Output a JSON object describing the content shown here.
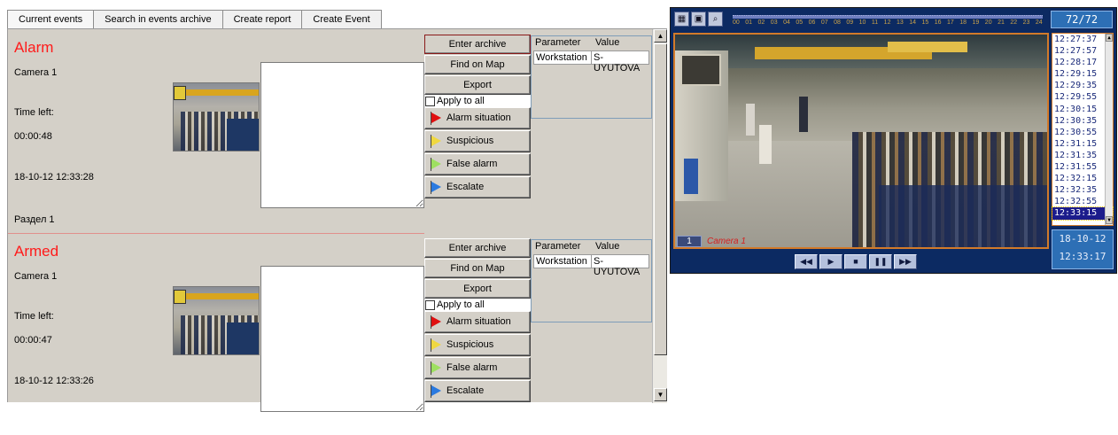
{
  "tabs": [
    {
      "label": "Current events"
    },
    {
      "label": "Search in events archive"
    },
    {
      "label": "Create report"
    },
    {
      "label": "Create Event"
    }
  ],
  "events": [
    {
      "title": "Alarm",
      "camera": "Camera 1",
      "time_left_label": "Time left:",
      "time_left": "00:00:48",
      "datetime": "18-10-12 12:33:28",
      "section": "Раздел 1",
      "params": {
        "header_param": "Parameter",
        "header_value": "Value",
        "rows": [
          {
            "param": "Workstation",
            "value": "S-UYUTOVA"
          }
        ]
      }
    },
    {
      "title": "Armed",
      "camera": "Camera 1",
      "time_left_label": "Time left:",
      "time_left": "00:00:47",
      "datetime": "18-10-12 12:33:26",
      "section": "",
      "params": {
        "header_param": "Parameter",
        "header_value": "Value",
        "rows": [
          {
            "param": "Workstation",
            "value": "S-UYUTOVA"
          }
        ]
      }
    }
  ],
  "buttons": {
    "enter_archive": "Enter archive",
    "find_on_map": "Find on Map",
    "export": "Export",
    "apply_to_all": "Apply to all",
    "alarm_situation": "Alarm situation",
    "suspicious_situation": "Suspicious situation",
    "false_alarm": "False alarm",
    "escalate": "Escalate"
  },
  "flag_colors": {
    "alarm": "#e01010",
    "suspicious": "#f0d840",
    "false": "#9ee060",
    "escalate": "#2a7ae0"
  },
  "video": {
    "counter": "72/72",
    "hours": [
      "00",
      "01",
      "02",
      "03",
      "04",
      "05",
      "06",
      "07",
      "08",
      "09",
      "10",
      "11",
      "12",
      "13",
      "14",
      "15",
      "16",
      "17",
      "18",
      "19",
      "20",
      "21",
      "22",
      "23",
      "24"
    ],
    "camera_number": "1",
    "camera_name": "Camera 1",
    "times": [
      "12:27:37",
      "12:27:57",
      "12:28:17",
      "12:29:15",
      "12:29:35",
      "12:29:55",
      "12:30:15",
      "12:30:35",
      "12:30:55",
      "12:31:15",
      "12:31:35",
      "12:31:55",
      "12:32:15",
      "12:32:35",
      "12:32:55",
      "12:33:15"
    ],
    "selected_time": "12:33:15",
    "date": "18-10-12",
    "time": "12:33:17",
    "toolbar_icons": [
      "layout-icon",
      "save-icon",
      "search-icon"
    ],
    "playback_icons": [
      "rewind-icon",
      "play-icon",
      "stop-icon",
      "pause-icon",
      "fast-forward-icon"
    ]
  },
  "accent_colors": {
    "title_red": "#ff1a1a",
    "video_border": "#d27a2a",
    "panel_blue": "#0c2a62"
  }
}
